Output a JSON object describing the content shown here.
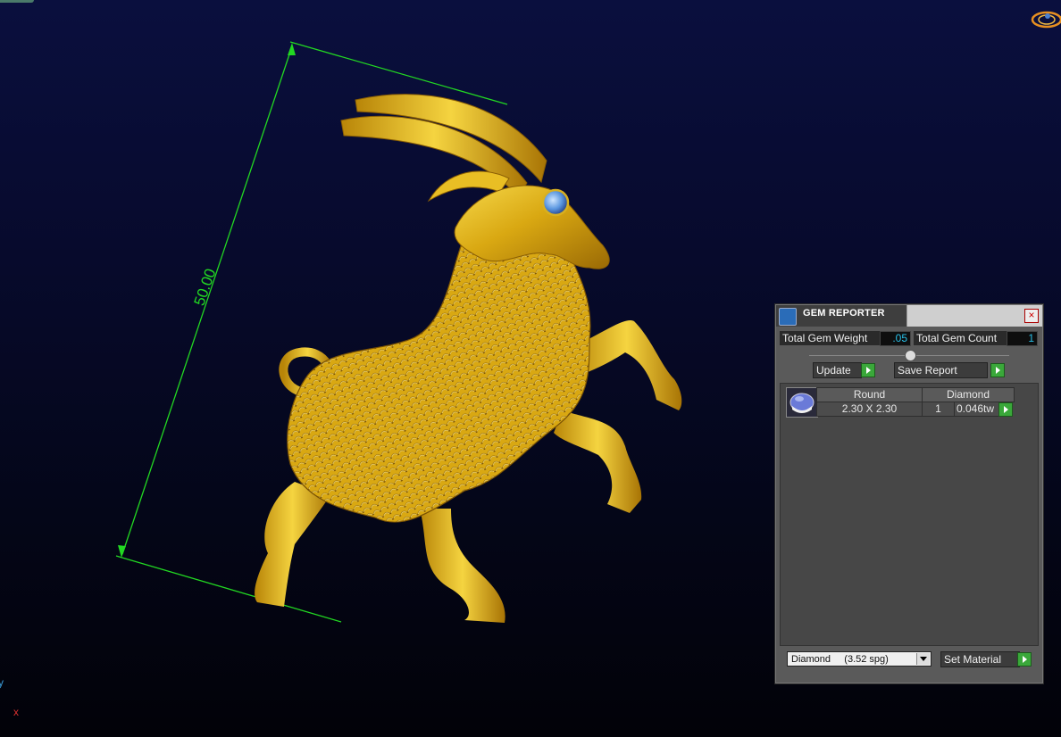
{
  "viewport": {
    "dimension_text": "50.00",
    "axis_labels": {
      "y": "y",
      "x": "x"
    },
    "colors": {
      "dimension": "#22d822",
      "gold": "#e8b81a",
      "gem": "#6aa8e8"
    }
  },
  "gem_reporter": {
    "title": "GEM REPORTER",
    "close_glyph": "×",
    "total_gem_weight_label": "Total Gem Weight",
    "total_gem_weight_value": ".05",
    "total_gem_count_label": "Total Gem Count",
    "total_gem_count_value": "1",
    "update_label": "Update",
    "save_report_label": "Save Report",
    "table": {
      "headers": [
        "Round",
        "Diamond"
      ],
      "rows": [
        {
          "size": "2.30 X 2.30",
          "count": "1",
          "weight": "0.046tw"
        }
      ]
    },
    "material_select_value": "Diamond     (3.52 spg)",
    "set_material_label": "Set Material"
  }
}
